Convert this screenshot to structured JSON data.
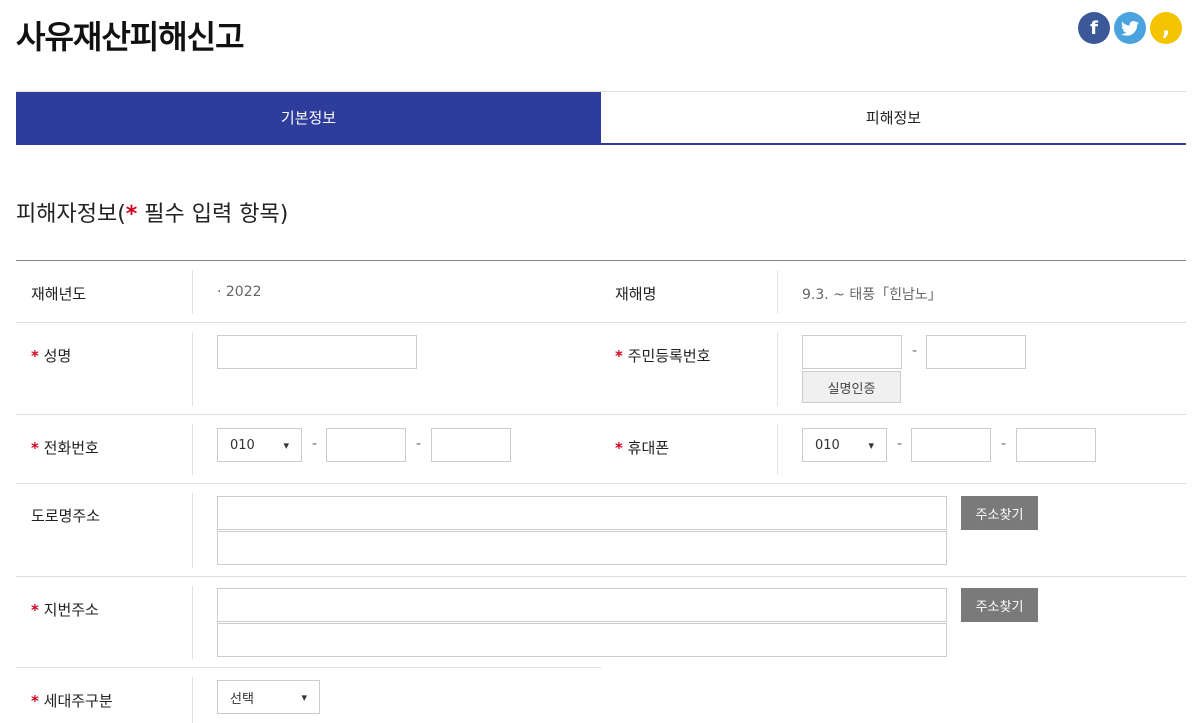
{
  "page": {
    "title": "사유재산피해신고",
    "social": {
      "facebook": "f",
      "twitter": "t",
      "kakaostory": ","
    },
    "tabs": [
      {
        "label": "기본정보",
        "active": true
      },
      {
        "label": "피해정보",
        "active": false
      }
    ],
    "section": {
      "title_prefix": "피해자정보(",
      "required_mark": "*",
      "title_suffix": " 필수 입력 항목)"
    }
  },
  "form": {
    "required_mark": "*",
    "disaster_year": {
      "label": "재해년도",
      "value": "· 2022"
    },
    "disaster_name": {
      "label": "재해명",
      "value": "9.3. ~ 태풍「힌남노」"
    },
    "name": {
      "label": "성명",
      "value": ""
    },
    "resident_number": {
      "label": "주민등록번호",
      "dash": "-",
      "verify_button": "실명인증"
    },
    "phone": {
      "label": "전화번호",
      "prefix": "010",
      "dash": "-"
    },
    "mobile": {
      "label": "휴대폰",
      "prefix": "010",
      "dash": "-"
    },
    "road_address": {
      "label": "도로명주소",
      "search_button": "주소찾기"
    },
    "lot_address": {
      "label": "지번주소",
      "search_button": "주소찾기"
    },
    "household_type": {
      "label": "세대주구분",
      "selected": "선택"
    }
  },
  "colors": {
    "primary": "#2e3d9c",
    "required": "#d0021b",
    "gray_button": "#7a7a7a"
  }
}
